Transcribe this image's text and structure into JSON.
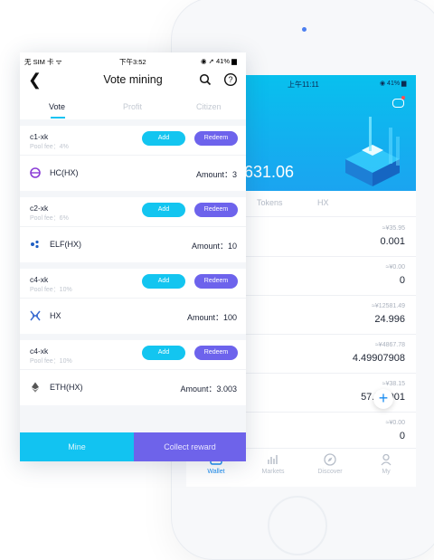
{
  "front": {
    "status": {
      "carrier": "无 SIM 卡 ᯤ",
      "time": "下午3:52",
      "battery": "◉ ➚ 41% ▆"
    },
    "title": "Vote mining",
    "tabs": [
      {
        "label": "Vote"
      },
      {
        "label": "Profit"
      },
      {
        "label": "Citizen"
      }
    ],
    "add_label": "Add",
    "redeem_label": "Redeem",
    "cards": [
      {
        "pool": "c1-xk",
        "fee": "Pool fee：4%",
        "coin": "HC(HX)",
        "amount": "Amount：3",
        "icon": "hc-coin-icon"
      },
      {
        "pool": "c2-xk",
        "fee": "Pool fee：6%",
        "coin": "ELF(HX)",
        "amount": "Amount：10",
        "icon": "elf-coin-icon"
      },
      {
        "pool": "c4-xk",
        "fee": "Pool fee：10%",
        "coin": "HX",
        "amount": "Amount：100",
        "icon": "hx-coin-icon"
      },
      {
        "pool": "c4-xk",
        "fee": "Pool fee：10%",
        "coin": "ETH(HX)",
        "amount": "Amount：3.003",
        "icon": "eth-coin-icon"
      }
    ],
    "mine_label": "Mine",
    "collect_label": "Collect reward"
  },
  "back": {
    "status_time": "上午11:11",
    "status_battery": "◉ 41% ▆",
    "balance": "631.06",
    "tabs": [
      "Tokens",
      "HX"
    ],
    "rows": [
      {
        "cny": "≈¥35.95",
        "amount": "0.001"
      },
      {
        "cny": "≈¥0.00",
        "amount": "0"
      },
      {
        "cny": "≈¥12581.49",
        "amount": "24.996"
      },
      {
        "cny": "≈¥4867.78",
        "amount": "4.49907908"
      },
      {
        "cny": "≈¥38.15",
        "amount": "57.70  001"
      },
      {
        "cny": "≈¥0.00",
        "amount": "0"
      }
    ],
    "nav": [
      {
        "label": "Wallet",
        "icon": "wallet-icon"
      },
      {
        "label": "Markets",
        "icon": "markets-icon"
      },
      {
        "label": "Discover",
        "icon": "compass-icon"
      },
      {
        "label": "My",
        "icon": "user-icon"
      }
    ]
  },
  "colors": {
    "cyan": "#13c5f0",
    "purple": "#6d63ec",
    "blue_header": "#1ba4f0"
  }
}
